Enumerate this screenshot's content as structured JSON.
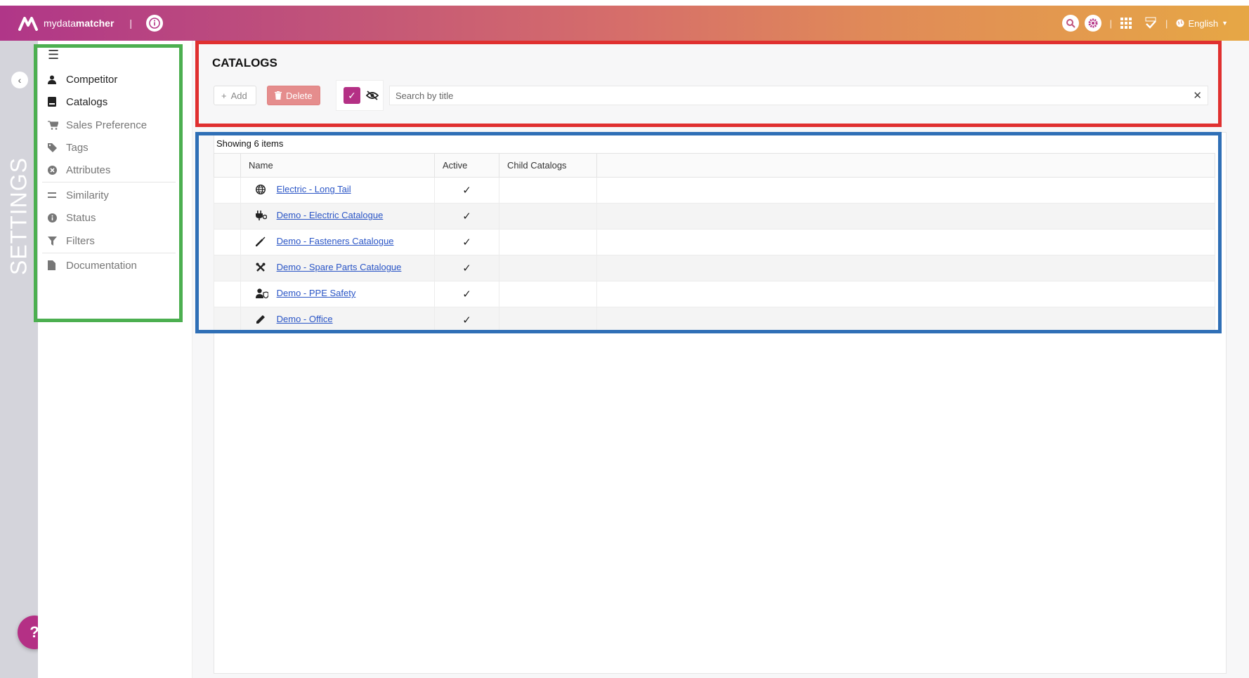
{
  "app": {
    "brand": "mydata",
    "brand_bold": "matcher",
    "language": "English"
  },
  "rail": {
    "label": "SETTINGS",
    "help": "?"
  },
  "sidebar": {
    "items": [
      {
        "label": "Competitor",
        "icon": "user-icon",
        "muted": false
      },
      {
        "label": "Catalogs",
        "icon": "book-icon",
        "muted": false
      },
      {
        "label": "Sales Preference",
        "icon": "cart-icon",
        "muted": true
      },
      {
        "label": "Tags",
        "icon": "tag-icon",
        "muted": true
      },
      {
        "label": "Attributes",
        "icon": "circle-x-icon",
        "muted": true
      },
      {
        "label": "Similarity",
        "icon": "equals-icon",
        "muted": true
      },
      {
        "label": "Status",
        "icon": "info-icon",
        "muted": true
      },
      {
        "label": "Filters",
        "icon": "filter-icon",
        "muted": true
      },
      {
        "label": "Documentation",
        "icon": "file-icon",
        "muted": true
      }
    ]
  },
  "page": {
    "title": "CATALOGS",
    "add_label": "Add",
    "delete_label": "Delete",
    "search_placeholder": "Search by title",
    "showing": "Showing 6 items"
  },
  "table": {
    "columns": [
      "Name",
      "Active",
      "Child Catalogs"
    ],
    "rows": [
      {
        "name": "Electric - Long Tail",
        "icon": "globe-icon",
        "active": "✓"
      },
      {
        "name": "Demo - Electric Catalogue",
        "icon": "plug-icon",
        "active": "✓"
      },
      {
        "name": "Demo - Fasteners Catalogue",
        "icon": "screwdriver-icon",
        "active": "✓"
      },
      {
        "name": "Demo - Spare Parts Catalogue",
        "icon": "tools-icon",
        "active": "✓"
      },
      {
        "name": "Demo - PPE Safety",
        "icon": "user-shield-icon",
        "active": "✓"
      },
      {
        "name": "Demo - Office",
        "icon": "pencil-icon",
        "active": "✓"
      }
    ]
  },
  "colors": {
    "accent": "#b43085",
    "delete": "#e58d8d",
    "link": "#2a55c6"
  }
}
